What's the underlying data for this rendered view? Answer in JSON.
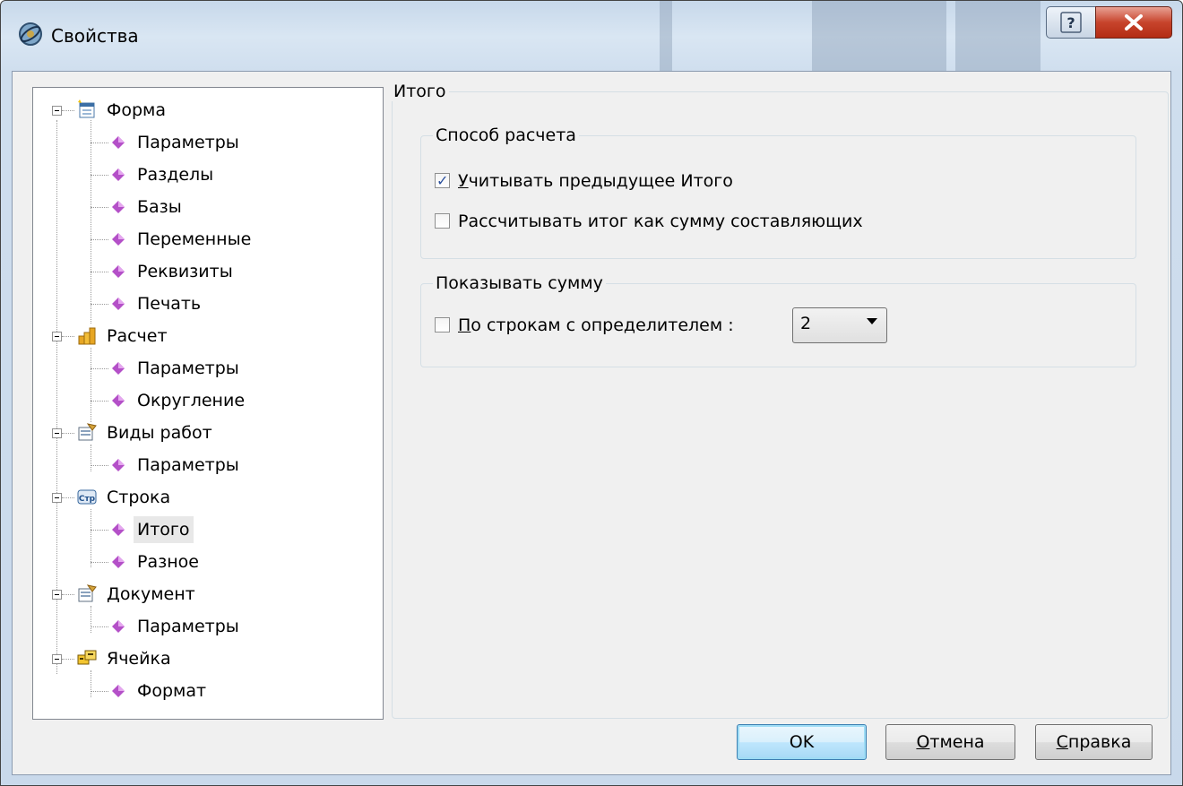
{
  "window": {
    "title": "Свойства"
  },
  "tree": {
    "categories": [
      {
        "label": "Форма",
        "icon": "form-icon",
        "children": [
          "Параметры",
          "Разделы",
          "Базы",
          "Переменные",
          "Реквизиты",
          "Печать"
        ]
      },
      {
        "label": "Расчет",
        "icon": "calc-coins-icon",
        "children": [
          "Параметры",
          "Округление"
        ]
      },
      {
        "label": "Виды работ",
        "icon": "work-types-icon",
        "children": [
          "Параметры"
        ]
      },
      {
        "label": "Строка",
        "icon": "row-str-icon",
        "children": [
          "Итого",
          "Разное"
        ]
      },
      {
        "label": "Документ",
        "icon": "document-icon",
        "children": [
          "Параметры"
        ]
      },
      {
        "label": "Ячейка",
        "icon": "cell-icon",
        "children": [
          "Формат"
        ]
      }
    ],
    "selected": "Строка / Итого"
  },
  "panel": {
    "title": "Итого",
    "calc_group": {
      "title": "Способ расчета",
      "options": [
        {
          "mnemonic": "У",
          "rest": "читывать предыдущее Итого",
          "checked": true
        },
        {
          "label": "Рассчитывать итог как сумму составляющих",
          "checked": false
        }
      ]
    },
    "show_group": {
      "title": "Показывать сумму",
      "option": {
        "mnemonic": "П",
        "rest": "о строкам с определителем :",
        "checked": false
      },
      "combo_value": "2"
    }
  },
  "buttons": {
    "ok": "OK",
    "cancel": {
      "mnemonic": "О",
      "rest": "тмена"
    },
    "help": {
      "mnemonic": "С",
      "rest": "правка"
    }
  }
}
